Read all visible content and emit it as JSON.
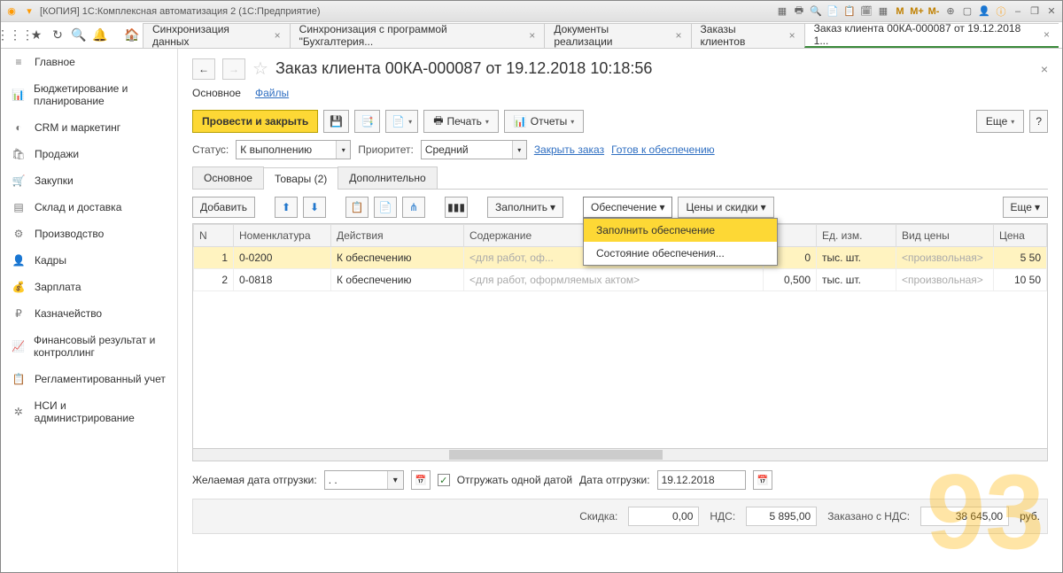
{
  "titlebar": {
    "text": "[КОПИЯ] 1С:Комплексная автоматизация 2  (1С:Предприятие)",
    "m1": "M",
    "m2": "M+",
    "m3": "M-"
  },
  "tabs": [
    {
      "label": "Синхронизация данных"
    },
    {
      "label": "Синхронизация с программой \"Бухгалтерия..."
    },
    {
      "label": "Документы реализации"
    },
    {
      "label": "Заказы клиентов"
    },
    {
      "label": "Заказ клиента 00КА-000087 от 19.12.2018 1...",
      "active": true
    }
  ],
  "sidebar": {
    "items": [
      {
        "icon": "≡",
        "label": "Главное"
      },
      {
        "icon": "📊",
        "label": "Бюджетирование и планирование"
      },
      {
        "icon": "◐",
        "label": "CRM и маркетинг"
      },
      {
        "icon": "🛍",
        "label": "Продажи"
      },
      {
        "icon": "🛒",
        "label": "Закупки"
      },
      {
        "icon": "▤",
        "label": "Склад и доставка"
      },
      {
        "icon": "⚙",
        "label": "Производство"
      },
      {
        "icon": "👤",
        "label": "Кадры"
      },
      {
        "icon": "💰",
        "label": "Зарплата"
      },
      {
        "icon": "₽",
        "label": "Казначейство"
      },
      {
        "icon": "📈",
        "label": "Финансовый результат и контроллинг"
      },
      {
        "icon": "📋",
        "label": "Регламентированный учет"
      },
      {
        "icon": "✲",
        "label": "НСИ и администрирование"
      }
    ]
  },
  "page": {
    "title": "Заказ клиента 00КА-000087 от 19.12.2018 10:18:56",
    "subnav_main": "Основное",
    "subnav_files": "Файлы"
  },
  "toolbar": {
    "submit": "Провести и закрыть",
    "print": "Печать",
    "reports": "Отчеты",
    "more": "Еще"
  },
  "status": {
    "label": "Статус:",
    "value": "К выполнению",
    "priority_label": "Приоритет:",
    "priority_value": "Средний",
    "close_order": "Закрыть заказ",
    "ready": "Готов к обеспечению"
  },
  "tabs2": {
    "main": "Основное",
    "goods": "Товары (2)",
    "extra": "Дополнительно"
  },
  "table_toolbar": {
    "add": "Добавить",
    "fill": "Заполнить",
    "provision": "Обеспечение",
    "prices": "Цены и скидки",
    "more": "Еще"
  },
  "dropdown": {
    "item1": "Заполнить обеспечение",
    "item2": "Состояние обеспечения..."
  },
  "grid": {
    "headers": {
      "n": "N",
      "nom": "Номенклатура",
      "act": "Действия",
      "cont": "Содержание",
      "qty": "",
      "unit": "Ед. изм.",
      "price_type": "Вид цены",
      "price": "Цена"
    },
    "rows": [
      {
        "n": "1",
        "nom": "0-0200",
        "act": "К обеспечению",
        "cont": "<для работ, оф...",
        "qty": "0",
        "unit": "тыс. шт.",
        "price_type": "<произвольная>",
        "price": "5 50"
      },
      {
        "n": "2",
        "nom": "0-0818",
        "act": "К обеспечению",
        "cont": "<для работ, оформляемых актом>",
        "qty": "0,500",
        "unit": "тыс. шт.",
        "price_type": "<произвольная>",
        "price": "10 50"
      }
    ]
  },
  "bottom": {
    "desired_label": "Желаемая дата отгрузки:",
    "desired_value": " . .",
    "single_date": "Отгружать одной датой",
    "ship_label": "Дата отгрузки:",
    "ship_value": "19.12.2018"
  },
  "totals": {
    "discount_label": "Скидка:",
    "discount": "0,00",
    "vat_label": "НДС:",
    "vat": "5 895,00",
    "order_label": "Заказано с НДС:",
    "order": "38 645,00",
    "cur": "руб."
  }
}
